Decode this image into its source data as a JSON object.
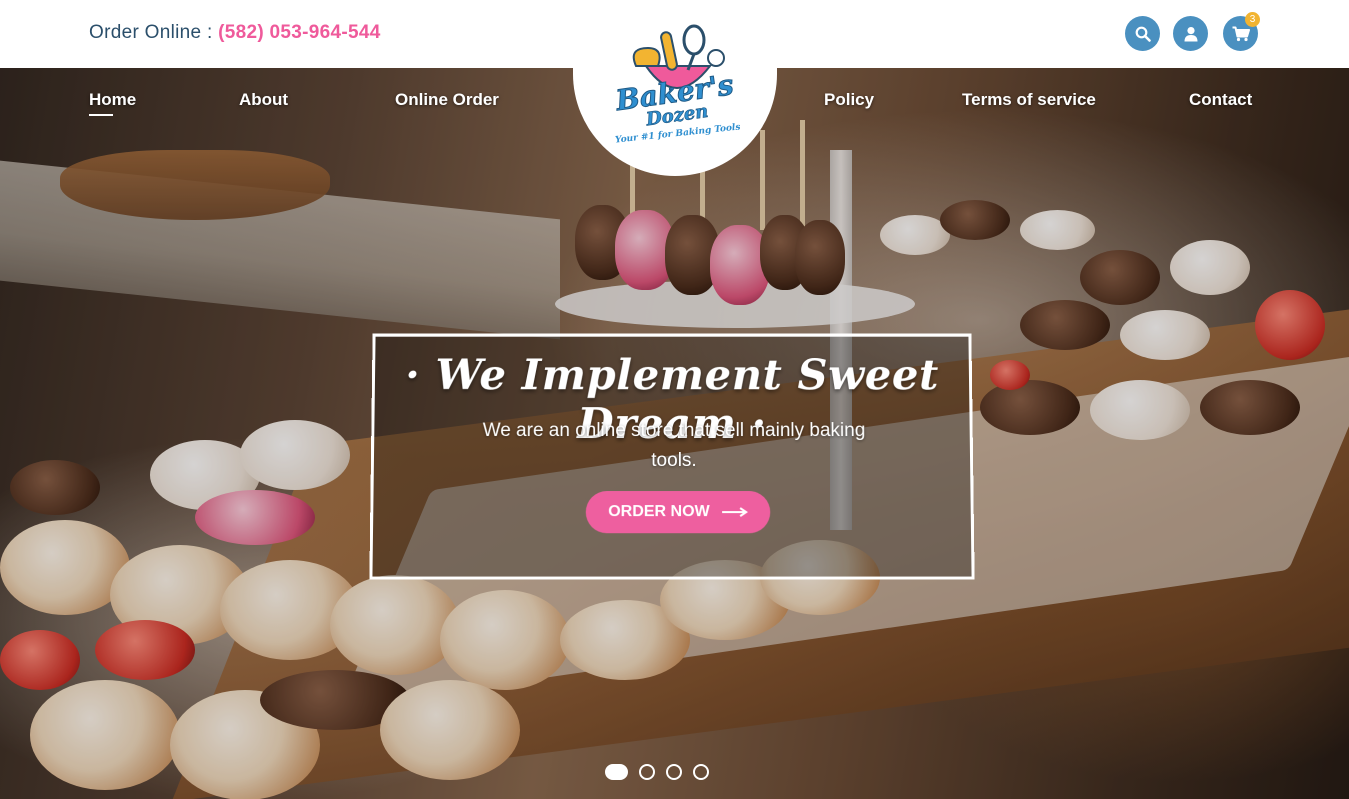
{
  "header": {
    "order_label": "Order Online :",
    "phone": "(582) 053-964-544",
    "cart_count": "3"
  },
  "logo": {
    "line1": "Baker's",
    "line2": "Dozen",
    "tagline": "Your #1 for Baking Tools"
  },
  "nav": {
    "items": [
      {
        "label": "Home"
      },
      {
        "label": "About"
      },
      {
        "label": "Online Order"
      },
      {
        "label": "Policy"
      },
      {
        "label": "Terms of service"
      },
      {
        "label": "Contact"
      }
    ],
    "active": "Home"
  },
  "hero": {
    "title": "· We Implement Sweet Dream ·",
    "subtitle": "We are an online store that sell mainly baking tools.",
    "button_label": "ORDER NOW"
  },
  "slider": {
    "slide_count": 4,
    "active_index": 1
  },
  "icons": [
    "search-icon",
    "user-icon",
    "cart-icon",
    "arrow-right-icon"
  ],
  "colors": {
    "accent_pink": "#ee5f9f",
    "icon_blue": "#4a90c0",
    "header_text": "#2b4f6b",
    "badge_yellow": "#f2b431"
  }
}
